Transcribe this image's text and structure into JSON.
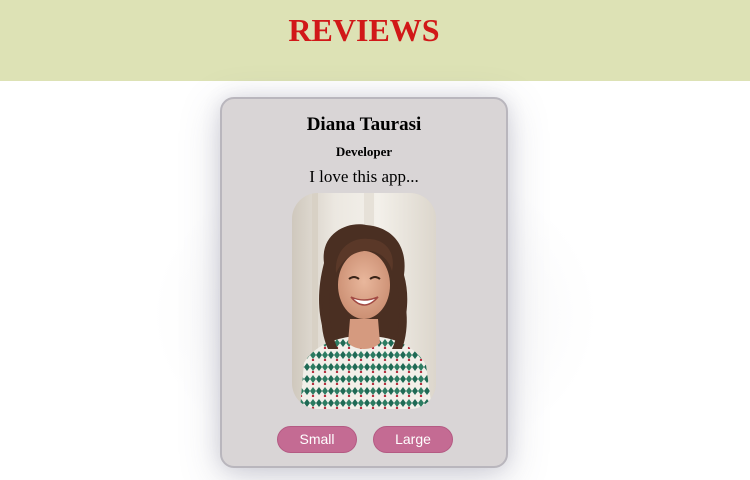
{
  "header": {
    "title": "REVIEWS",
    "background": "#dde2b5",
    "title_color": "#d11818"
  },
  "review": {
    "name": "Diana Taurasi",
    "role": "Developer",
    "quote": "I love this app...",
    "photo_label": "smiling woman portrait"
  },
  "buttons": {
    "small_label": "Small",
    "large_label": "Large",
    "color": "#c46b93"
  },
  "card": {
    "background": "#d9d5d6"
  }
}
